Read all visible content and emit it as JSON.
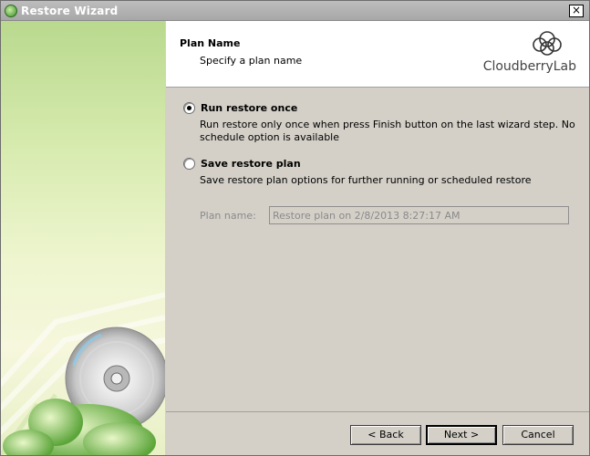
{
  "window": {
    "title": "Restore Wizard",
    "close_glyph": "×"
  },
  "header": {
    "title": "Plan Name",
    "subtitle": "Specify a plan name",
    "logo_text": "CloudberryLab"
  },
  "options": [
    {
      "label": "Run restore once",
      "description_line1": "Run restore only once when press Finish button on the last wizard step. No",
      "description_line2": "schedule option is available",
      "selected": true
    },
    {
      "label": "Save restore plan",
      "description_line1": "Save restore plan options for further running or scheduled restore",
      "selected": false
    }
  ],
  "plan": {
    "label": "Plan name:",
    "value": "Restore plan on 2/8/2013 8:27:17 AM",
    "enabled": false
  },
  "buttons": {
    "back": "< Back",
    "next": "Next >",
    "cancel": "Cancel"
  },
  "colors": {
    "sidebar_green": "#b9d98e",
    "dialog_gray": "#d4d0c8"
  }
}
